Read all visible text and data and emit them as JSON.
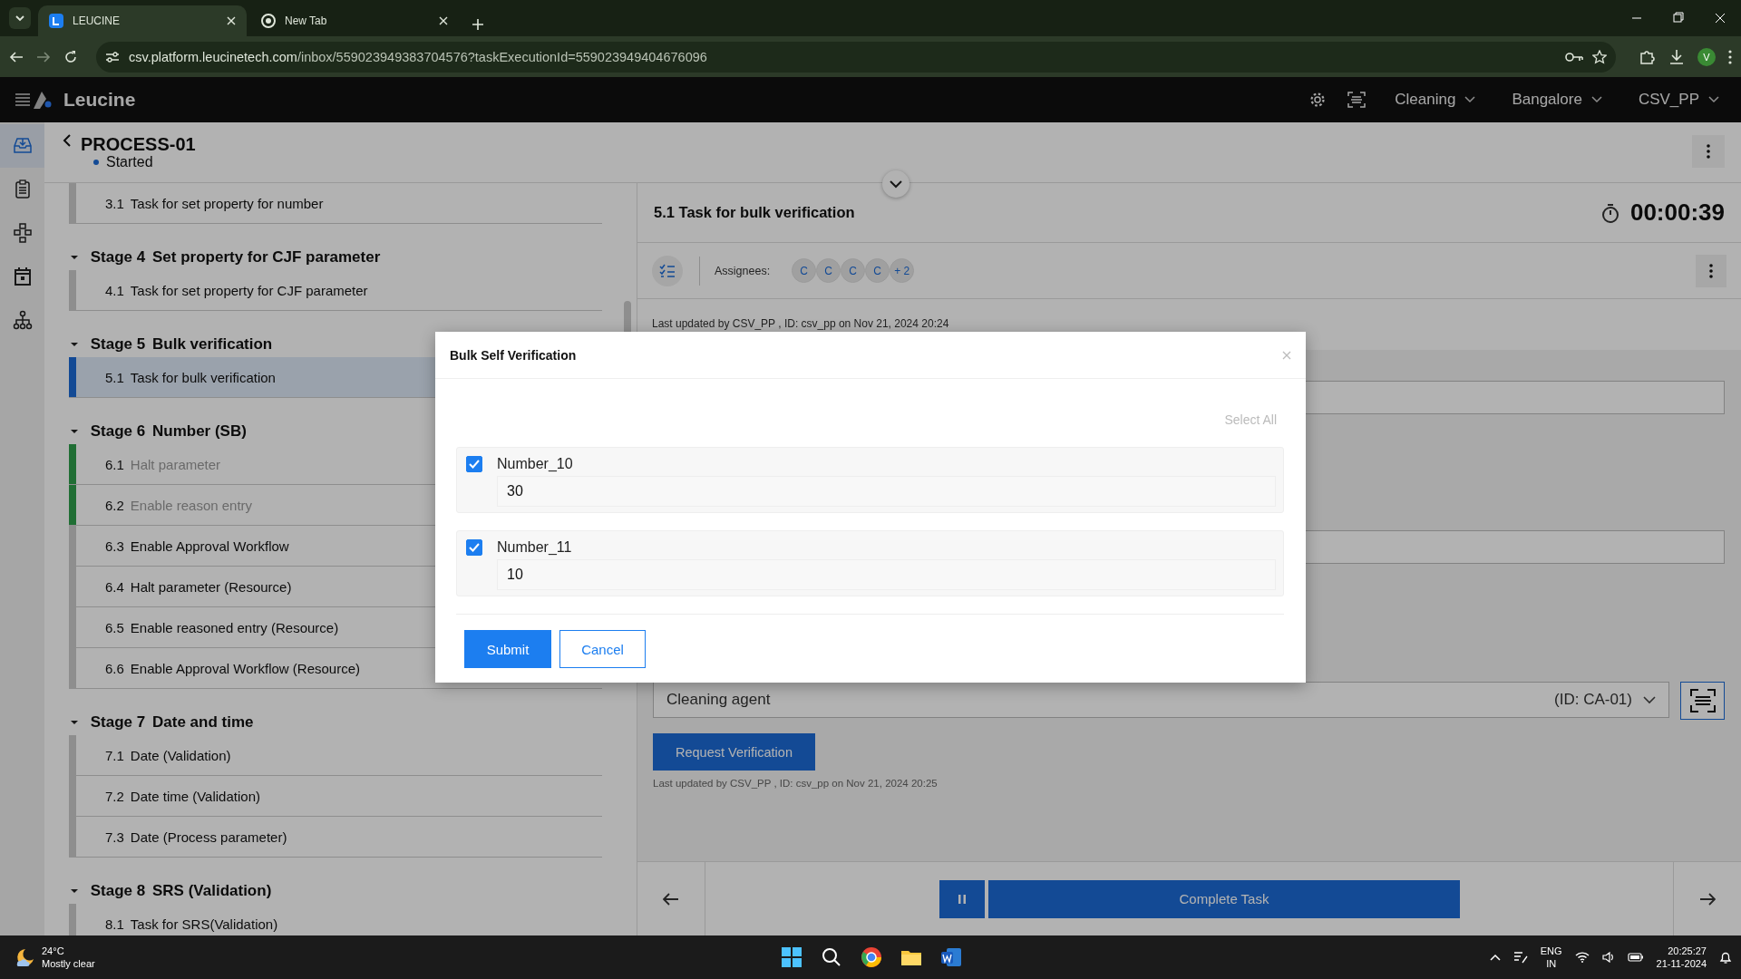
{
  "browser": {
    "tabs": [
      {
        "title": "LEUCINE",
        "selected": true
      },
      {
        "title": "New Tab",
        "selected": false
      }
    ],
    "url_host": "csv.platform.leucinetech.com",
    "url_path": "/inbox/559023949383704576?taskExecutionId=559023949404676096",
    "profile": "V"
  },
  "app_header": {
    "brand": "Leucine",
    "selectors": [
      "Cleaning",
      "Bangalore",
      "CSV_PP"
    ]
  },
  "nav": [
    {
      "selected": true
    },
    {
      "selected": false
    },
    {
      "selected": false
    },
    {
      "selected": false
    },
    {
      "selected": false
    }
  ],
  "process": {
    "title": "PROCESS-01",
    "status": "Started"
  },
  "stages": [
    {
      "tasks": [
        {
          "number": "3.1",
          "name": "Task for set property for number",
          "completed": false,
          "selected": false
        }
      ]
    },
    {
      "label": "Stage 4",
      "name": "Set property for CJF parameter",
      "expanded": true,
      "tasks": [
        {
          "number": "4.1",
          "name": "Task for set property for CJF parameter",
          "completed": false,
          "selected": false
        }
      ]
    },
    {
      "label": "Stage 5",
      "name": "Bulk verification",
      "expanded": true,
      "tasks": [
        {
          "number": "5.1",
          "name": "Task for bulk verification",
          "completed": false,
          "selected": true
        }
      ]
    },
    {
      "label": "Stage 6",
      "name": "Number (SB)",
      "expanded": true,
      "tasks": [
        {
          "number": "6.1",
          "name": "Halt parameter",
          "completed": true,
          "selected": false
        },
        {
          "number": "6.2",
          "name": "Enable reason entry",
          "completed": true,
          "selected": false
        },
        {
          "number": "6.3",
          "name": "Enable Approval Workflow",
          "completed": false,
          "selected": false
        },
        {
          "number": "6.4",
          "name": "Halt parameter (Resource)",
          "completed": false,
          "selected": false
        },
        {
          "number": "6.5",
          "name": "Enable reasoned entry (Resource)",
          "completed": false,
          "selected": false
        },
        {
          "number": "6.6",
          "name": "Enable Approval Workflow (Resource)",
          "completed": false,
          "selected": false
        }
      ]
    },
    {
      "label": "Stage 7",
      "name": "Date and time",
      "expanded": true,
      "tasks": [
        {
          "number": "7.1",
          "name": "Date (Validation)",
          "completed": false,
          "selected": false
        },
        {
          "number": "7.2",
          "name": "Date time (Validation)",
          "completed": false,
          "selected": false
        },
        {
          "number": "7.3",
          "name": "Date (Process parameter)",
          "completed": false,
          "selected": false
        }
      ]
    },
    {
      "label": "Stage 8",
      "name": "SRS (Validation)",
      "expanded": true,
      "tasks": [
        {
          "number": "8.1",
          "name": "Task for SRS(Validation)",
          "completed": false,
          "selected": false
        }
      ]
    }
  ],
  "task": {
    "title": "5.1 Task for bulk verification",
    "timer": "00:00:39",
    "assignees_label": "Assignees:",
    "assignees": [
      "C",
      "C",
      "C",
      "C",
      "+ 2"
    ],
    "last_updated": "Last updated by CSV_PP , ID: csv_pp on Nov 21, 2024 20:24"
  },
  "parameter": {
    "value": "Cleaning agent",
    "id": "(ID: CA-01)",
    "button": "Request Verification",
    "last_updated": "Last updated by CSV_PP , ID: csv_pp on Nov 21, 2024 20:25"
  },
  "footer": {
    "complete": "Complete Task"
  },
  "modal": {
    "title": "Bulk Self Verification",
    "select_all": {
      "label": "Select All",
      "disabled": true
    },
    "items": [
      {
        "label": "Number_10",
        "value": "30",
        "checked": true
      },
      {
        "label": "Number_11",
        "value": "10",
        "checked": true
      }
    ],
    "submit": "Submit",
    "cancel": "Cancel"
  },
  "taskbar": {
    "temperature": "24°C",
    "weather": "Mostly clear",
    "lang": "ENG",
    "region": "IN",
    "time": "20:25:27",
    "date": "21-11-2024"
  }
}
